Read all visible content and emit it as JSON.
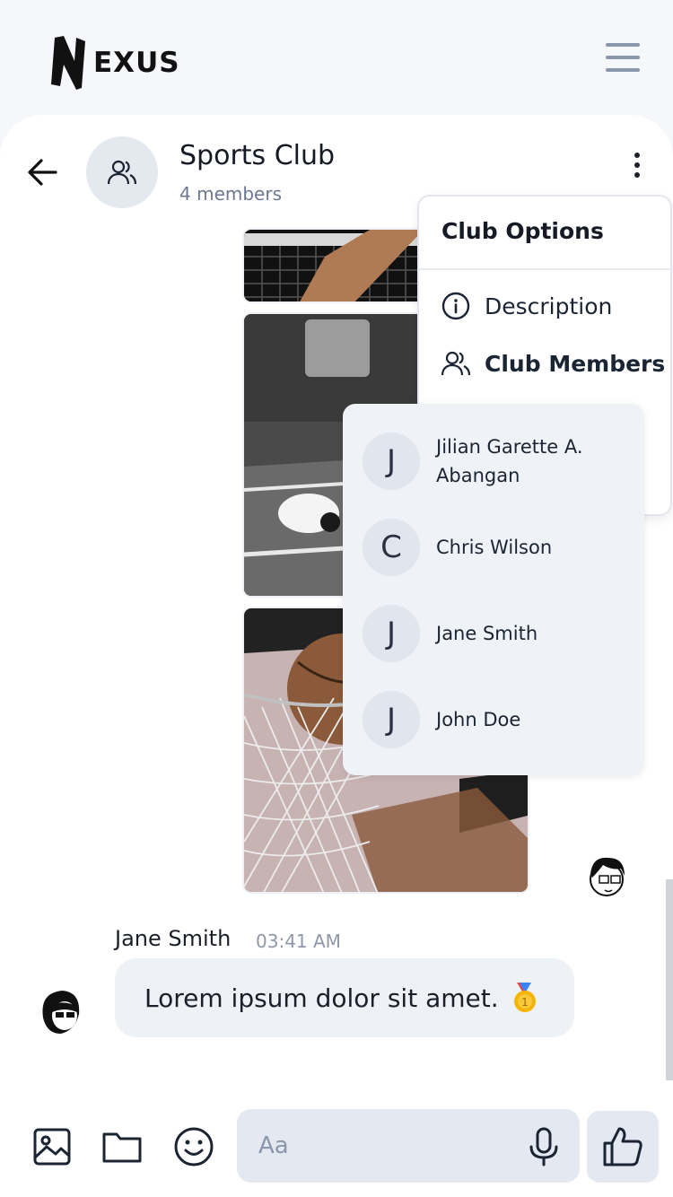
{
  "app": {
    "logo_text": "EXUS"
  },
  "chat": {
    "title": "Sports Club",
    "subtitle": "4 members"
  },
  "message": {
    "sender": "Jane Smith",
    "time": "03:41 AM",
    "text": "Lorem ipsum dolor sit amet."
  },
  "composer": {
    "placeholder": "Aa"
  },
  "options_menu": {
    "title": "Club Options",
    "items": [
      {
        "label": "Description",
        "icon": "info-icon"
      },
      {
        "label": "Club Members",
        "icon": "users-icon"
      }
    ]
  },
  "members": [
    {
      "initial": "J",
      "name": "Jilian Garette A. Abangan"
    },
    {
      "initial": "C",
      "name": "Chris Wilson"
    },
    {
      "initial": "J",
      "name": "Jane Smith"
    },
    {
      "initial": "J",
      "name": "John Doe"
    }
  ],
  "colors": {
    "background": "#f5f7fa",
    "accent_gray": "#8a97ab",
    "bubble": "#eef1f6",
    "input": "#e4e9f1"
  }
}
